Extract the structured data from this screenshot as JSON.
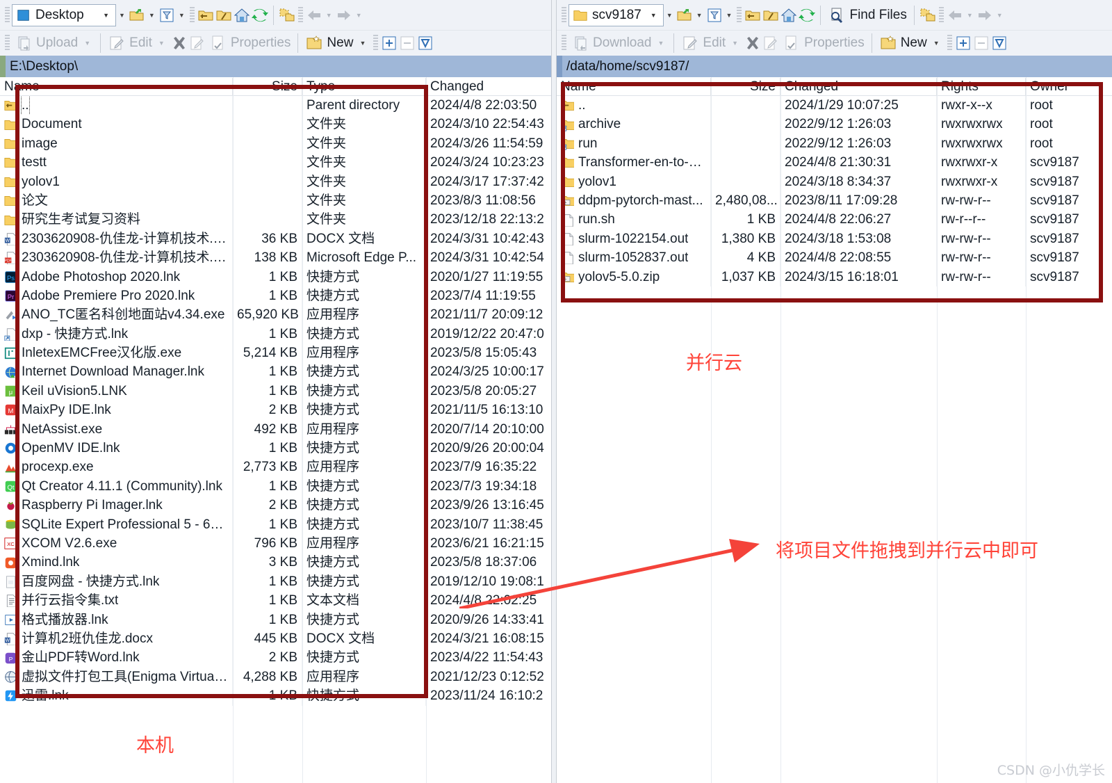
{
  "left": {
    "toolbar": {
      "combo_value": "Desktop",
      "caret": "▾",
      "icons": [
        "open-folder-icon",
        "filter-icon",
        "parent-folder-icon",
        "root-folder-icon",
        "home-icon",
        "refresh-icon",
        "copy-folder-icon",
        "back-arrow-icon",
        "forward-arrow-icon"
      ],
      "row2": {
        "upload_label": "Upload",
        "edit_label": "Edit",
        "properties_label": "Properties",
        "new_label": "New",
        "delete_icon": "x-delete-icon",
        "rename_icon": "rename-icon",
        "plus_icon": "select-plus-icon",
        "minus_icon": "select-minus-icon",
        "invert_icon": "invert-selection-icon"
      }
    },
    "path": "E:\\Desktop\\",
    "columns": [
      "Name",
      "Size",
      "Type",
      "Changed"
    ],
    "rows": [
      {
        "icon": "parent-folder-icon",
        "name": "..",
        "size": "",
        "type": "Parent directory",
        "changed": "2024/4/8  22:03:50",
        "selected": true
      },
      {
        "icon": "folder-icon",
        "name": "Document",
        "size": "",
        "type": "文件夹",
        "changed": "2024/3/10  22:54:43"
      },
      {
        "icon": "folder-icon",
        "name": "image",
        "size": "",
        "type": "文件夹",
        "changed": "2024/3/26  11:54:59"
      },
      {
        "icon": "folder-icon",
        "name": "testt",
        "size": "",
        "type": "文件夹",
        "changed": "2024/3/24  10:23:23"
      },
      {
        "icon": "folder-icon",
        "name": "yolov1",
        "size": "",
        "type": "文件夹",
        "changed": "2024/3/17  17:37:42"
      },
      {
        "icon": "folder-icon",
        "name": "论文",
        "size": "",
        "type": "文件夹",
        "changed": "2023/8/3  11:08:56"
      },
      {
        "icon": "folder-icon",
        "name": "研究生考试复习资料",
        "size": "",
        "type": "文件夹",
        "changed": "2023/12/18  22:13:2"
      },
      {
        "icon": "word-doc-icon",
        "name": "2303620908-仇佳龙-计算机技术.d...",
        "size": "36 KB",
        "type": "DOCX 文档",
        "changed": "2024/3/31  10:42:43"
      },
      {
        "icon": "pdf-icon",
        "name": "2303620908-仇佳龙-计算机技术.p...",
        "size": "138 KB",
        "type": "Microsoft Edge P...",
        "changed": "2024/3/31  10:42:54"
      },
      {
        "icon": "photoshop-icon",
        "name": "Adobe Photoshop 2020.lnk",
        "size": "1 KB",
        "type": "快捷方式",
        "changed": "2020/1/27  11:19:55"
      },
      {
        "icon": "premiere-icon",
        "name": "Adobe Premiere Pro 2020.lnk",
        "size": "1 KB",
        "type": "快捷方式",
        "changed": "2023/7/4  11:19:55"
      },
      {
        "icon": "app-icon",
        "name": "ANO_TC匿名科创地面站v4.34.exe",
        "size": "65,920 KB",
        "type": "应用程序",
        "changed": "2021/11/7  20:09:12"
      },
      {
        "icon": "shortcut-icon",
        "name": "dxp - 快捷方式.lnk",
        "size": "1 KB",
        "type": "快捷方式",
        "changed": "2019/12/22  20:47:0"
      },
      {
        "icon": "inletex-icon",
        "name": "InletexEMCFree汉化版.exe",
        "size": "5,214 KB",
        "type": "应用程序",
        "changed": "2023/5/8  15:05:43"
      },
      {
        "icon": "idm-icon",
        "name": "Internet Download Manager.lnk",
        "size": "1 KB",
        "type": "快捷方式",
        "changed": "2024/3/25  10:00:17"
      },
      {
        "icon": "keil-icon",
        "name": "Keil uVision5.LNK",
        "size": "1 KB",
        "type": "快捷方式",
        "changed": "2023/5/8  20:05:27"
      },
      {
        "icon": "maixpy-icon",
        "name": "MaixPy IDE.lnk",
        "size": "2 KB",
        "type": "快捷方式",
        "changed": "2021/11/5  16:13:10"
      },
      {
        "icon": "netassist-icon",
        "name": "NetAssist.exe",
        "size": "492 KB",
        "type": "应用程序",
        "changed": "2020/7/14  20:10:00"
      },
      {
        "icon": "openmv-icon",
        "name": "OpenMV IDE.lnk",
        "size": "1 KB",
        "type": "快捷方式",
        "changed": "2020/9/26  20:00:04"
      },
      {
        "icon": "procexp-icon",
        "name": "procexp.exe",
        "size": "2,773 KB",
        "type": "应用程序",
        "changed": "2023/7/9  16:35:22"
      },
      {
        "icon": "qt-icon",
        "name": "Qt Creator 4.11.1 (Community).lnk",
        "size": "1 KB",
        "type": "快捷方式",
        "changed": "2023/7/3  19:34:18"
      },
      {
        "icon": "raspberry-icon",
        "name": "Raspberry Pi Imager.lnk",
        "size": "2 KB",
        "type": "快捷方式",
        "changed": "2023/9/26  13:16:45"
      },
      {
        "icon": "sqlite-icon",
        "name": "SQLite Expert Professional 5 - 64...",
        "size": "1 KB",
        "type": "快捷方式",
        "changed": "2023/10/7  11:38:45"
      },
      {
        "icon": "xcom-icon",
        "name": "XCOM V2.6.exe",
        "size": "796 KB",
        "type": "应用程序",
        "changed": "2023/6/21  16:21:15"
      },
      {
        "icon": "xmind-icon",
        "name": "Xmind.lnk",
        "size": "3 KB",
        "type": "快捷方式",
        "changed": "2023/5/8  18:37:06"
      },
      {
        "icon": "baidu-icon",
        "name": "百度网盘 - 快捷方式.lnk",
        "size": "1 KB",
        "type": "快捷方式",
        "changed": "2019/12/10  19:08:1"
      },
      {
        "icon": "text-icon",
        "name": "并行云指令集.txt",
        "size": "1 KB",
        "type": "文本文档",
        "changed": "2024/4/8  22:02:25"
      },
      {
        "icon": "player-icon",
        "name": "格式播放器.lnk",
        "size": "1 KB",
        "type": "快捷方式",
        "changed": "2020/9/26  14:33:41"
      },
      {
        "icon": "word-doc-icon",
        "name": "计算机2班仇佳龙.docx",
        "size": "445 KB",
        "type": "DOCX 文档",
        "changed": "2024/3/21  16:08:15"
      },
      {
        "icon": "kingsoft-icon",
        "name": "金山PDF转Word.lnk",
        "size": "2 KB",
        "type": "快捷方式",
        "changed": "2023/4/22  11:54:43"
      },
      {
        "icon": "enigma-icon",
        "name": "虚拟文件打包工具(Enigma Virtual ...",
        "size": "4,288 KB",
        "type": "应用程序",
        "changed": "2021/12/23  0:12:52"
      },
      {
        "icon": "thunder-icon",
        "name": "迅雷.lnk",
        "size": "1 KB",
        "type": "快捷方式",
        "changed": "2023/11/24  16:10:2"
      }
    ],
    "annotation_label": "本机"
  },
  "right": {
    "toolbar": {
      "combo_value": "scv9187",
      "caret": "▾",
      "find_files_label": "Find Files",
      "row2": {
        "download_label": "Download",
        "edit_label": "Edit",
        "properties_label": "Properties",
        "new_label": "New"
      }
    },
    "path": "/data/home/scv9187/",
    "columns": [
      "Name",
      "Size",
      "Changed",
      "Rights",
      "Owner"
    ],
    "rows": [
      {
        "icon": "parent-folder-icon",
        "name": "..",
        "size": "",
        "changed": "2024/1/29 10:07:25",
        "rights": "rwxr-x--x",
        "owner": "root"
      },
      {
        "icon": "folder-link-icon",
        "name": "archive",
        "size": "",
        "changed": "2022/9/12 1:26:03",
        "rights": "rwxrwxrwx",
        "owner": "root"
      },
      {
        "icon": "folder-link-icon",
        "name": "run",
        "size": "",
        "changed": "2022/9/12 1:26:03",
        "rights": "rwxrwxrwx",
        "owner": "root"
      },
      {
        "icon": "folder-icon",
        "name": "Transformer-en-to-c...",
        "size": "",
        "changed": "2024/4/8 21:30:31",
        "rights": "rwxrwxr-x",
        "owner": "scv9187"
      },
      {
        "icon": "folder-icon",
        "name": "yolov1",
        "size": "",
        "changed": "2024/3/18 8:34:37",
        "rights": "rwxrwxr-x",
        "owner": "scv9187"
      },
      {
        "icon": "zip-icon",
        "name": "ddpm-pytorch-mast...",
        "size": "2,480,08...",
        "changed": "2023/8/11 17:09:28",
        "rights": "rw-rw-r--",
        "owner": "scv9187"
      },
      {
        "icon": "file-icon",
        "name": "run.sh",
        "size": "1 KB",
        "changed": "2024/4/8 22:06:27",
        "rights": "rw-r--r--",
        "owner": "scv9187"
      },
      {
        "icon": "file-icon",
        "name": "slurm-1022154.out",
        "size": "1,380 KB",
        "changed": "2024/3/18 1:53:08",
        "rights": "rw-rw-r--",
        "owner": "scv9187"
      },
      {
        "icon": "file-icon",
        "name": "slurm-1052837.out",
        "size": "4 KB",
        "changed": "2024/4/8 22:08:55",
        "rights": "rw-rw-r--",
        "owner": "scv9187"
      },
      {
        "icon": "zip-icon",
        "name": "yolov5-5.0.zip",
        "size": "1,037 KB",
        "changed": "2024/3/15 16:18:01",
        "rights": "rw-rw-r--",
        "owner": "scv9187"
      }
    ],
    "annotation_cloud": "并行云",
    "annotation_hint": "将项目文件拖拽到并行云中即可"
  },
  "watermark": "CSDN @小仇学长",
  "colors": {
    "annotation_box": "#8a1010",
    "annotation_text": "#ff4338",
    "path_bar": "#9fb7d8",
    "toolbar_bg": "#eff2f7"
  }
}
